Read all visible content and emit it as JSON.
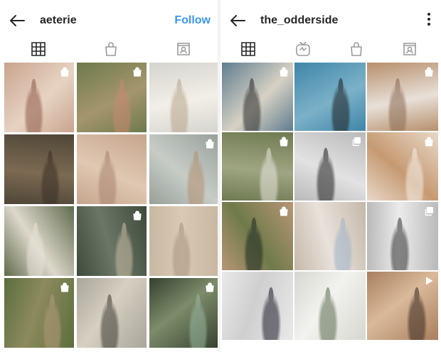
{
  "left_profile": {
    "username": "aeterie",
    "follow_label": "Follow",
    "tabs": [
      "grid-icon",
      "shopping-bag-icon",
      "tagged-icon"
    ],
    "posts": [
      {
        "icon": "shopping-bag-icon",
        "colors": [
          "#c9a48e",
          "#e7d3c3",
          "#8f5a4a"
        ]
      },
      {
        "icon": "shopping-bag-icon",
        "colors": [
          "#6d7a4c",
          "#a5956d",
          "#c98a6f"
        ]
      },
      {
        "icon": "",
        "colors": [
          "#d6d4cf",
          "#f2efe8",
          "#b8a58a"
        ]
      },
      {
        "icon": "",
        "colors": [
          "#4f4638",
          "#7c6a52",
          "#3a3028"
        ]
      },
      {
        "icon": "",
        "colors": [
          "#c6a58e",
          "#e0c8b2",
          "#a98470"
        ]
      },
      {
        "icon": "shopping-bag-icon",
        "colors": [
          "#98a09a",
          "#c7ccc7",
          "#b49070"
        ]
      },
      {
        "icon": "",
        "colors": [
          "#5f6b4c",
          "#ded8cc",
          "#e9e4da"
        ]
      },
      {
        "icon": "shopping-bag-icon",
        "colors": [
          "#3e4a3a",
          "#6b7766",
          "#cbbca6"
        ]
      },
      {
        "icon": "",
        "colors": [
          "#c8b7a1",
          "#d9c9b5",
          "#a99480"
        ]
      },
      {
        "icon": "shopping-bag-icon",
        "colors": [
          "#5b6e3c",
          "#8c8a5e",
          "#b59a7b"
        ]
      },
      {
        "icon": "",
        "colors": [
          "#a8a69a",
          "#d7cfc2",
          "#3b3a32"
        ]
      },
      {
        "icon": "shopping-bag-icon",
        "colors": [
          "#35402e",
          "#7d8c6a",
          "#9ab7a2"
        ]
      }
    ]
  },
  "right_profile": {
    "username": "the_odderside",
    "tabs": [
      "grid-icon",
      "igtv-icon",
      "shopping-bag-icon",
      "tagged-icon"
    ],
    "posts": [
      {
        "icon": "shopping-bag-icon",
        "colors": [
          "#5f7d8f",
          "#d7d1c4",
          "#2a2a2a"
        ]
      },
      {
        "icon": "",
        "colors": [
          "#3f85a8",
          "#7bb1c8",
          "#1e1e1e"
        ]
      },
      {
        "icon": "shopping-bag-icon",
        "colors": [
          "#b78f6c",
          "#e8e0d8",
          "#8b6a52"
        ]
      },
      {
        "icon": "shopping-bag-icon",
        "colors": [
          "#6f7a52",
          "#9fa582",
          "#e9e6e0"
        ]
      },
      {
        "icon": "copy-icon",
        "colors": [
          "#b9b9b9",
          "#e2e2e2",
          "#1f1f1f"
        ]
      },
      {
        "icon": "shopping-bag-icon",
        "colors": [
          "#e8d8c8",
          "#c69a72",
          "#f6f0ea"
        ]
      },
      {
        "icon": "shopping-bag-icon",
        "colors": [
          "#b89676",
          "#6f7a4a",
          "#1e2b24"
        ]
      },
      {
        "icon": "",
        "colors": [
          "#c5b8a8",
          "#e8e2dc",
          "#9fb3c8"
        ]
      },
      {
        "icon": "copy-icon",
        "colors": [
          "#b9b9b9",
          "#ebebeb",
          "#2f2f2f"
        ]
      },
      {
        "icon": "",
        "colors": [
          "#e9e9e9",
          "#cfcfcf",
          "#1b1b2a"
        ]
      },
      {
        "icon": "",
        "colors": [
          "#d7d7d2",
          "#f2f2ee",
          "#5b6b4e"
        ]
      },
      {
        "icon": "play-icon",
        "colors": [
          "#a87f5e",
          "#d9b99a",
          "#3a2a20"
        ]
      }
    ]
  }
}
